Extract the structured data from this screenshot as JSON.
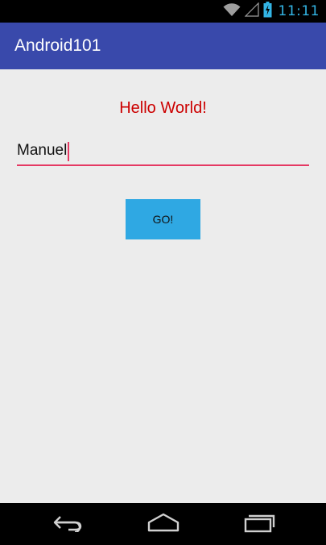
{
  "status_bar": {
    "time": "11:11",
    "icons": [
      "wifi-icon",
      "signal-icon",
      "battery-charging-icon"
    ]
  },
  "app_bar": {
    "title": "Android101"
  },
  "main": {
    "hello_text": "Hello World!",
    "name_input_value": "Manuel",
    "go_button_label": "GO!"
  },
  "nav_bar": {
    "icons": [
      "back-icon",
      "home-icon",
      "recents-icon"
    ]
  },
  "colors": {
    "app_bar": "#3949ab",
    "hello_text": "#cc0000",
    "input_underline": "#e53963",
    "button": "#2fa8e3",
    "status_time": "#33b5e5",
    "background": "#ececec"
  }
}
